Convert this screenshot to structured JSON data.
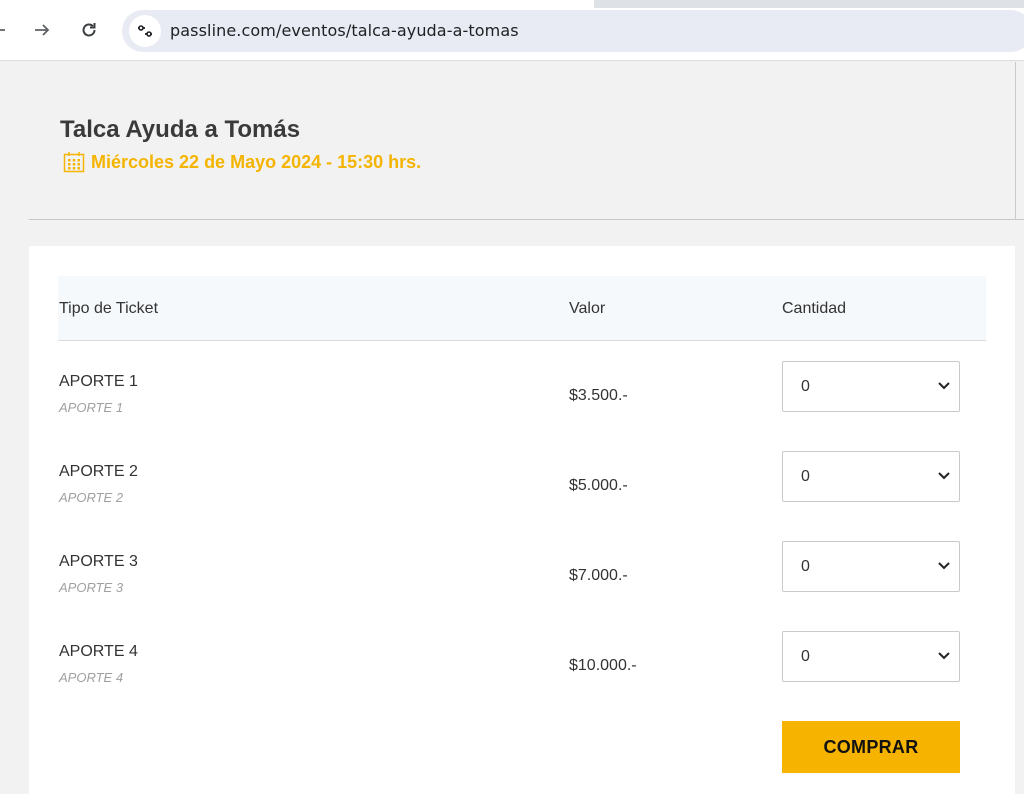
{
  "browser": {
    "url": "passline.com/eventos/talca-ayuda-a-tomas"
  },
  "event": {
    "title": "Talca Ayuda a Tomás",
    "date": "Miércoles 22 de Mayo 2024 - 15:30 hrs."
  },
  "table": {
    "headers": {
      "type": "Tipo de Ticket",
      "value": "Valor",
      "quantity": "Cantidad"
    },
    "rows": [
      {
        "name": "APORTE 1",
        "subtitle": "APORTE 1",
        "price": "$3.500.-",
        "quantity": "0"
      },
      {
        "name": "APORTE 2",
        "subtitle": "APORTE 2",
        "price": "$5.000.-",
        "quantity": "0"
      },
      {
        "name": "APORTE 3",
        "subtitle": "APORTE 3",
        "price": "$7.000.-",
        "quantity": "0"
      },
      {
        "name": "APORTE 4",
        "subtitle": "APORTE 4",
        "price": "$10.000.-",
        "quantity": "0"
      }
    ]
  },
  "actions": {
    "buy_label": "COMPRAR"
  },
  "colors": {
    "accent": "#f6b300",
    "date_text": "#f4b400"
  },
  "icons": [
    "back-arrow-icon",
    "forward-arrow-icon",
    "reload-icon",
    "site-settings-icon",
    "calendar-icon",
    "chevron-down-icon"
  ]
}
